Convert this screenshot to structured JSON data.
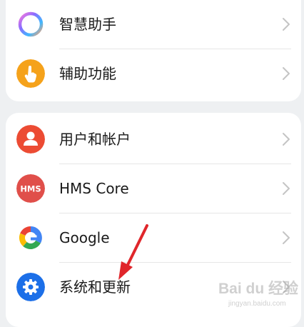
{
  "settings_group_1": {
    "items": [
      {
        "label": "智慧助手",
        "icon": "assistant-ring-icon"
      },
      {
        "label": "辅助功能",
        "icon": "hand-icon",
        "color": "#f5a21b"
      }
    ]
  },
  "settings_group_2": {
    "items": [
      {
        "label": "用户和帐户",
        "icon": "user-icon",
        "color": "#ec4b33"
      },
      {
        "label": "HMS Core",
        "icon": "hms-core-icon",
        "icon_text": "HMS",
        "color": "#e04f4a"
      },
      {
        "label": "Google",
        "icon": "google-icon"
      },
      {
        "label": "系统和更新",
        "icon": "gear-icon",
        "color": "#1c6fe8"
      }
    ]
  },
  "watermark": {
    "text": "Bai du 经验",
    "sub": "jingyan.baidu.com"
  },
  "colors": {
    "background": "#eef0f2",
    "card": "#ffffff",
    "arrow": "#e0262b"
  }
}
